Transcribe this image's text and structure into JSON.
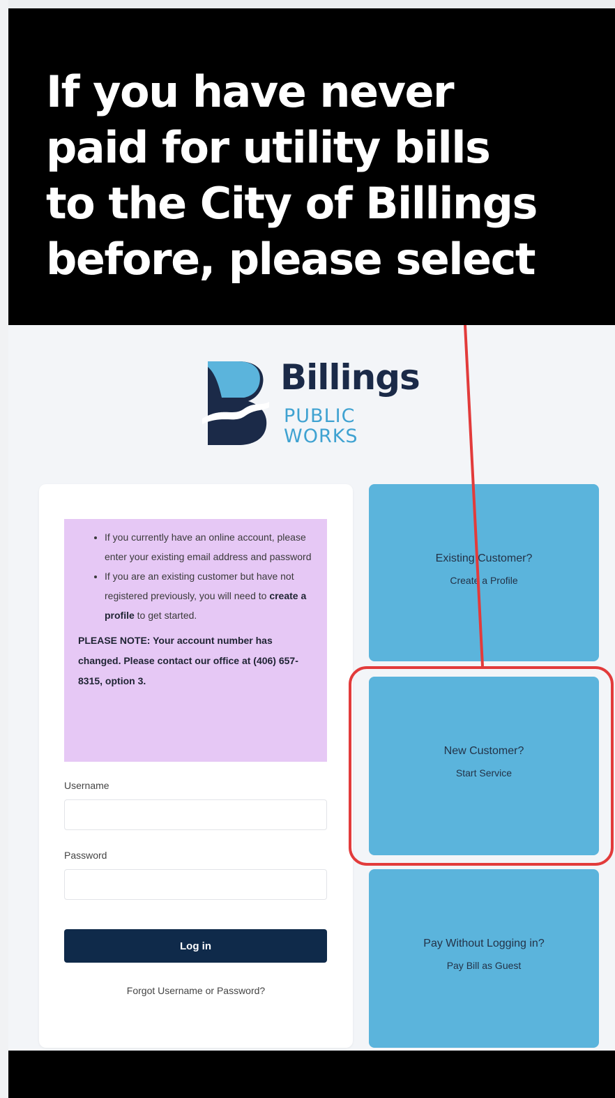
{
  "headline": {
    "line1": "If you have never",
    "line2": "paid for utility bills",
    "line3": "to the City of Billings",
    "line4": "before, please select"
  },
  "logo": {
    "title": "Billings",
    "subtitle_line1": "PUBLIC",
    "subtitle_line2": "WORKS"
  },
  "login": {
    "notice_items": [
      "If you currently have an online account, please enter your existing email address and password",
      "If you are an existing customer but have not registered previously, you will need to "
    ],
    "notice_link": "create a profile",
    "notice_link_after": " to get started.",
    "note": "PLEASE NOTE: Your account number has changed. Please contact our office at (406) 657-8315, option 3.",
    "username_label": "Username",
    "username_value": "",
    "password_label": "Password",
    "password_value": "",
    "login_button": "Log in",
    "forgot_link": "Forgot Username or Password?"
  },
  "tiles": [
    {
      "title": "Existing Customer?",
      "sub": "Create a Profile"
    },
    {
      "title": "New Customer?",
      "sub": "Start Service"
    },
    {
      "title": "Pay Without Logging in?",
      "sub": "Pay Bill as Guest"
    }
  ],
  "colors": {
    "tile": "#5bb4dc",
    "login_button": "#0f2a4a",
    "notice_bg": "#e6c8f5",
    "annotation_red": "#e23b3b",
    "logo_navy": "#1b2a48",
    "logo_blue": "#3fa2d1"
  }
}
